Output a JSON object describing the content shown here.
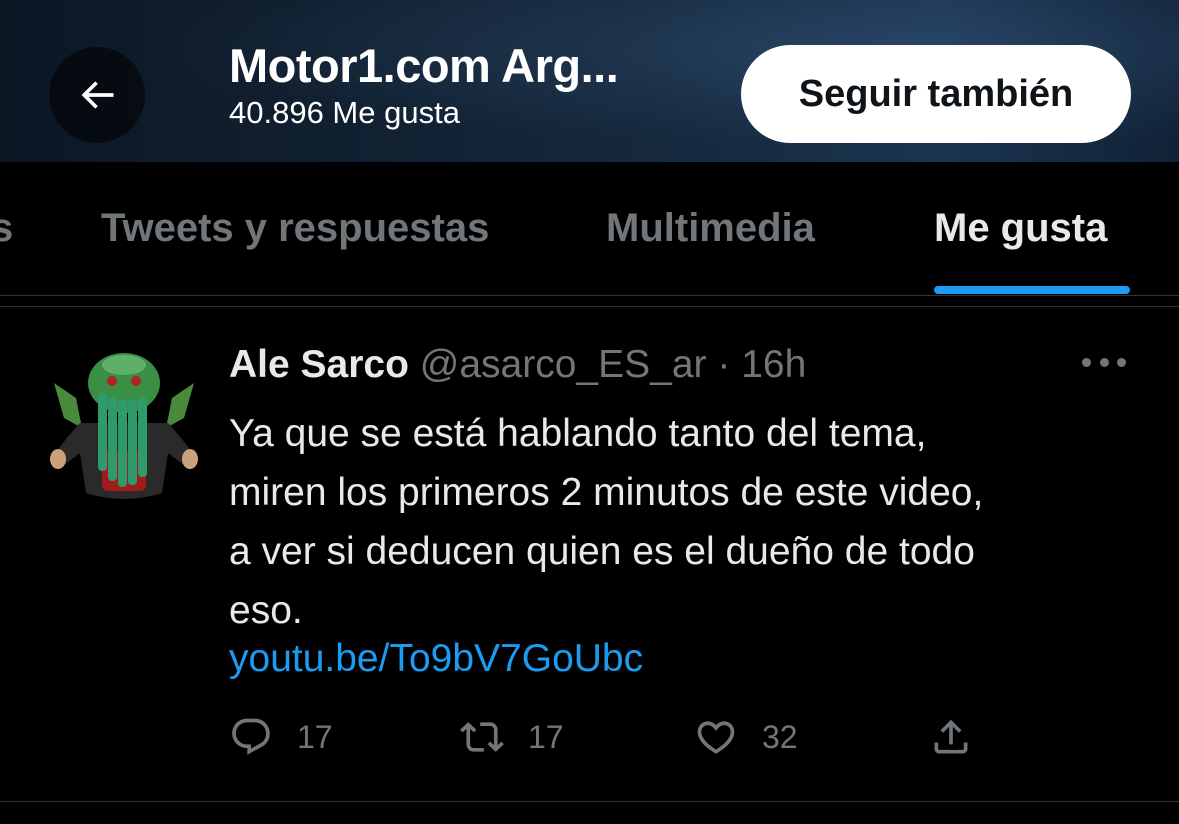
{
  "header": {
    "title": "Motor1.com Arg...",
    "subtitle": "40.896 Me gusta",
    "follow_label": "Seguir también"
  },
  "tabs": [
    {
      "label": "s"
    },
    {
      "label": "Tweets y respuestas"
    },
    {
      "label": "Multimedia"
    },
    {
      "label": "Me gusta",
      "active": true
    }
  ],
  "tweet": {
    "author": "Ale Sarco",
    "handle": "@asarco_ES_ar",
    "separator": "·",
    "time": "16h",
    "lines": [
      "Ya que se está hablando tanto del tema,",
      "miren los primeros 2 minutos de este video,",
      "a ver si deducen quien es el dueño de todo",
      "eso."
    ],
    "link": "youtu.be/To9bV7GoUbc",
    "replies": "17",
    "retweets": "17",
    "likes": "32"
  },
  "icons": {
    "back": "arrow-left-icon",
    "more": "more-horizontal-icon",
    "reply": "reply-icon",
    "retweet": "retweet-icon",
    "like": "heart-icon",
    "share": "share-icon"
  },
  "colors": {
    "accent": "#1d9bf0",
    "muted": "#71767b",
    "background": "#000000"
  }
}
